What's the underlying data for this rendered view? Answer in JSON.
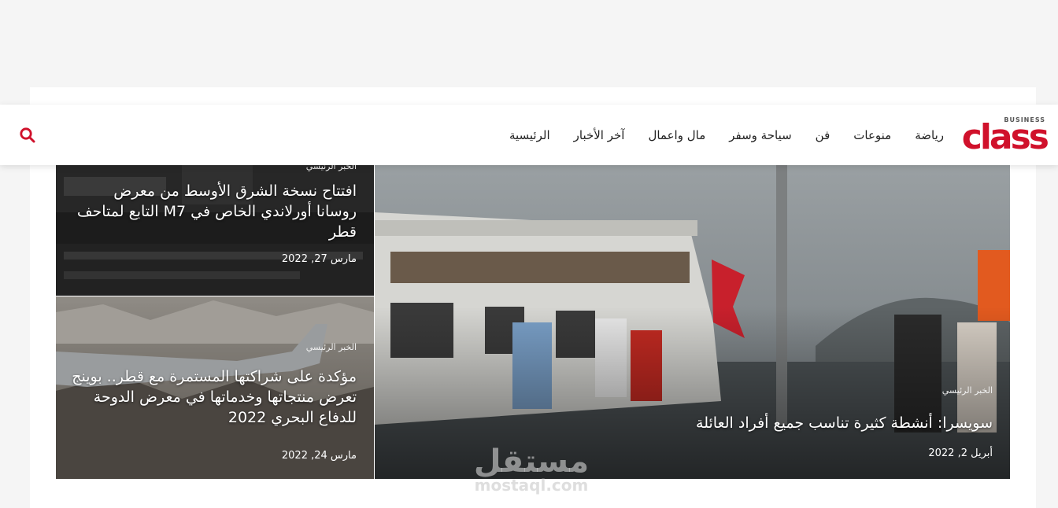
{
  "header": {
    "logo_main": "class",
    "logo_sub": "BUSINESS",
    "nav": [
      "الرئيسية",
      "آخر الأخبار",
      "مال واعمال",
      "سياحة وسفر",
      "فن",
      "منوعات",
      "رياضة"
    ],
    "search_icon": "search-icon",
    "accent_color": "#d0112b"
  },
  "featured": {
    "main": {
      "category": "الخبر الرئيسي",
      "title": "سويسرا: أنشطة كثيرة تناسب جميع أفراد العائلة",
      "date": "أبريل 2, 2022"
    },
    "top_right": {
      "category": "الخبر الرئيسي",
      "title": "افتتاح نسخة الشرق الأوسط من معرض روسانا أورلاندي الخاص في M7 التابع لمتاحف قطر",
      "date": "مارس 27, 2022"
    },
    "bottom_right": {
      "category": "الخبر الرئيسي",
      "title": "مؤكدة على شراكتها المستمرة مع قطر.. بوينج تعرض منتجاتها وخدماتها في معرض الدوحة للدفاع البحري 2022",
      "date": "مارس 24, 2022"
    }
  },
  "watermark": {
    "arabic": "مستقل",
    "latin": "mostaql.com"
  }
}
